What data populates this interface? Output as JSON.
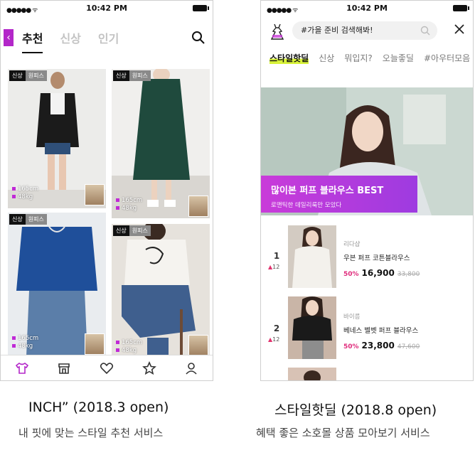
{
  "status_bar": {
    "time": "10:42 PM",
    "signal": "●●●●● ᯤ"
  },
  "left_app": {
    "back_glyph": "‹",
    "tabs": [
      {
        "label": "추천",
        "active": true
      },
      {
        "label": "신상",
        "active": false
      },
      {
        "label": "인기",
        "active": false
      }
    ],
    "cards": [
      {
        "tag1": "신상",
        "tag2": "원피스",
        "height": "165cm",
        "weight": "48kg"
      },
      {
        "tag1": "신상",
        "tag2": "원피스",
        "height": "165cm",
        "weight": "48kg"
      },
      {
        "tag1": "신상",
        "tag2": "원피스",
        "height": "165cm",
        "weight": "48kg"
      },
      {
        "tag1": "신상",
        "tag2": "원피스",
        "height": "165cm",
        "weight": "48kg"
      }
    ],
    "nav_icons": [
      "shirt-icon",
      "shop-icon",
      "heart-icon",
      "star-icon",
      "user-icon"
    ],
    "accent": "#b327c9"
  },
  "right_app": {
    "search_placeholder": "#가을 준비 검색해봐!",
    "categories": [
      {
        "label": "스타일핫딜",
        "active": true
      },
      {
        "label": "신상",
        "active": false
      },
      {
        "label": "뭐입지?",
        "active": false
      },
      {
        "label": "오늘좋딜",
        "active": false
      },
      {
        "label": "#아우터모음",
        "active": false
      }
    ],
    "banner": {
      "title": "많이본 퍼프 블라우스 BEST",
      "subtitle": "로맨틱한 데일리룩만 모았다"
    },
    "ranks": [
      {
        "rank": "1",
        "change": "12",
        "shop": "리다샵",
        "name": "우븐 퍼프 코튼블라우스",
        "discount": "50%",
        "price": "16,900",
        "original": "33,800"
      },
      {
        "rank": "2",
        "change": "12",
        "shop": "바이름",
        "name": "베네스 벨벳 퍼프 블라우스",
        "discount": "50%",
        "price": "23,800",
        "original": "47,600"
      }
    ],
    "accent": "#c93bd9"
  },
  "captions": {
    "left_title": "INCH” (2018.3 open)",
    "left_sub": "내 핏에 맞는 스타일 추천 서비스",
    "right_title": "스타일핫딜 (2018.8 open)",
    "right_sub": "혜택 좋은 소호몰 상품 모아보기 서비스"
  }
}
